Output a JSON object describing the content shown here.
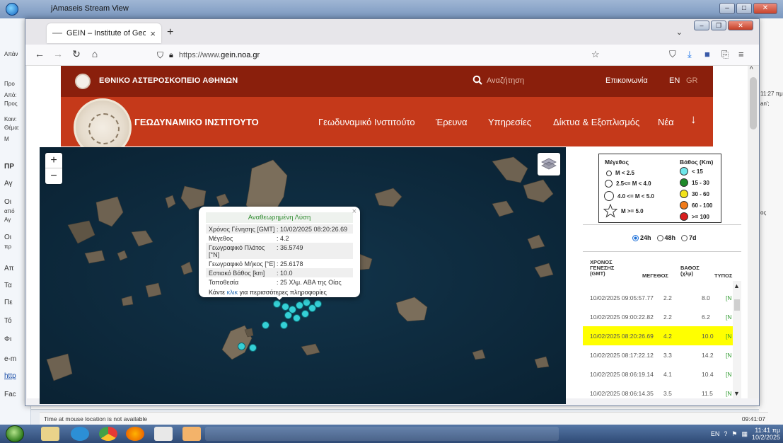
{
  "bg_window": {
    "title": "jAmaseis Stream View"
  },
  "bg_left_labels": [
    "Απάν",
    "Προ",
    "Από:",
    "Προς",
    "Κοιν:",
    "Θέμα:",
    "Μ"
  ],
  "bg_doc_labels": [
    "ΠΡ",
    "Αγ",
    "Οι",
    "από",
    "Αγ",
    "Οι",
    "πρ",
    "Απ",
    "Τα",
    "Πε",
    "Τό",
    "Φι",
    "e-m",
    "http",
    "Fac"
  ],
  "bg_right_labels": [
    "11:27 πμ",
    "an';",
    "ος"
  ],
  "browser": {
    "tab_title": "GEIN – Institute of Geodynamic",
    "tab_close": "×",
    "new_tab": "+",
    "url_prefix": "https://www.",
    "url_host": "gein.noa.gr"
  },
  "site": {
    "observatory": "ΕΘΝΙΚΟ ΑΣΤΕΡΟΣΚΟΠΕΙΟ ΑΘΗΝΩΝ",
    "search_placeholder": "Αναζήτηση",
    "contact": "Επικοινωνία",
    "lang_en": "EN",
    "lang_gr": "GR",
    "institute": "ΓΕΩΔΥΝΑΜΙΚΟ ΙΝΣΤΙΤΟΥΤΟ",
    "menu": [
      "Γεωδυναμικό Ινστιτούτο",
      "Έρευνα",
      "Υπηρεσίες",
      "Δίκτυα & Εξοπλισμός",
      "Νέα"
    ],
    "arrow": "↓"
  },
  "map": {
    "zoom_in": "+",
    "zoom_out": "−",
    "popup": {
      "title": "Αναθεωρημένη Λύση",
      "close": "×",
      "rows": [
        {
          "k": "Χρόνος Γένησης [GMT]",
          "v": ": 10/02/2025 08:20:26.69"
        },
        {
          "k": "Μέγεθος",
          "v": ": 4.2"
        },
        {
          "k": "Γεωγραφικό Πλάτος [°N]",
          "v": ": 36.5749"
        },
        {
          "k": "Γεωγραφικό Μήκος [°E]",
          "v": ": 25.6178"
        },
        {
          "k": "Εστιακό Βάθος [km]",
          "v": ": 10.0"
        },
        {
          "k": "Τοποθεσία",
          "v": ": 25 Χλμ. ΑΒΑ της Οίας"
        }
      ],
      "more_pre": "Κάντε ",
      "more_link": "κλικ",
      "more_post": " για περισσότερες πληροφορίες"
    }
  },
  "legend": {
    "mag_title": "Μέγεθος",
    "depth_title": "Βάθος (Km)",
    "mag_items": [
      "M < 2.5",
      "2.5<= M < 4.0",
      "4.0 <= M < 5.0",
      "M >= 5.0"
    ],
    "depth_items": [
      {
        "label": "< 15",
        "color": "#6fe6ea"
      },
      {
        "label": "15 - 30",
        "color": "#1f8a2a"
      },
      {
        "label": "30 - 60",
        "color": "#f2e21a"
      },
      {
        "label": "60 - 100",
        "color": "#f07a1a"
      },
      {
        "label": ">= 100",
        "color": "#d81e1e"
      }
    ]
  },
  "time_filter": [
    "24h",
    "48h",
    "7d"
  ],
  "table": {
    "headers": [
      "ΧΡΟΝΟΣ\nΓΕΝΕΣΗΣ\n(GMT)",
      "ΜΕΓΕΘΟΣ",
      "ΒΑΘΟΣ\n(χλμ)",
      "ΤΥΠΟΣ"
    ],
    "rows": [
      {
        "time": "10/02/2025 09:05:57.77",
        "mag": "2.2",
        "depth": "8.0",
        "type": "[Ν"
      },
      {
        "time": "10/02/2025 09:00:22.82",
        "mag": "2.2",
        "depth": "6.2",
        "type": "[Ν"
      },
      {
        "time": "10/02/2025 08:20:26.69",
        "mag": "4.2",
        "depth": "10.0",
        "type": "[Ν",
        "highlight": true
      },
      {
        "time": "10/02/2025 08:17:22.12",
        "mag": "3.3",
        "depth": "14.2",
        "type": "[Ν"
      },
      {
        "time": "10/02/2025 08:06:19.14",
        "mag": "4.1",
        "depth": "10.4",
        "type": "[Ν"
      },
      {
        "time": "10/02/2025 08:06:14.35",
        "mag": "3.5",
        "depth": "11.5",
        "type": "[Ν"
      }
    ]
  },
  "status": {
    "left": "Time at mouse location is not available",
    "right": "09:41:07"
  },
  "taskbar": {
    "lang": "EN",
    "time": "11:41 πμ",
    "date": "10/2/2025"
  }
}
